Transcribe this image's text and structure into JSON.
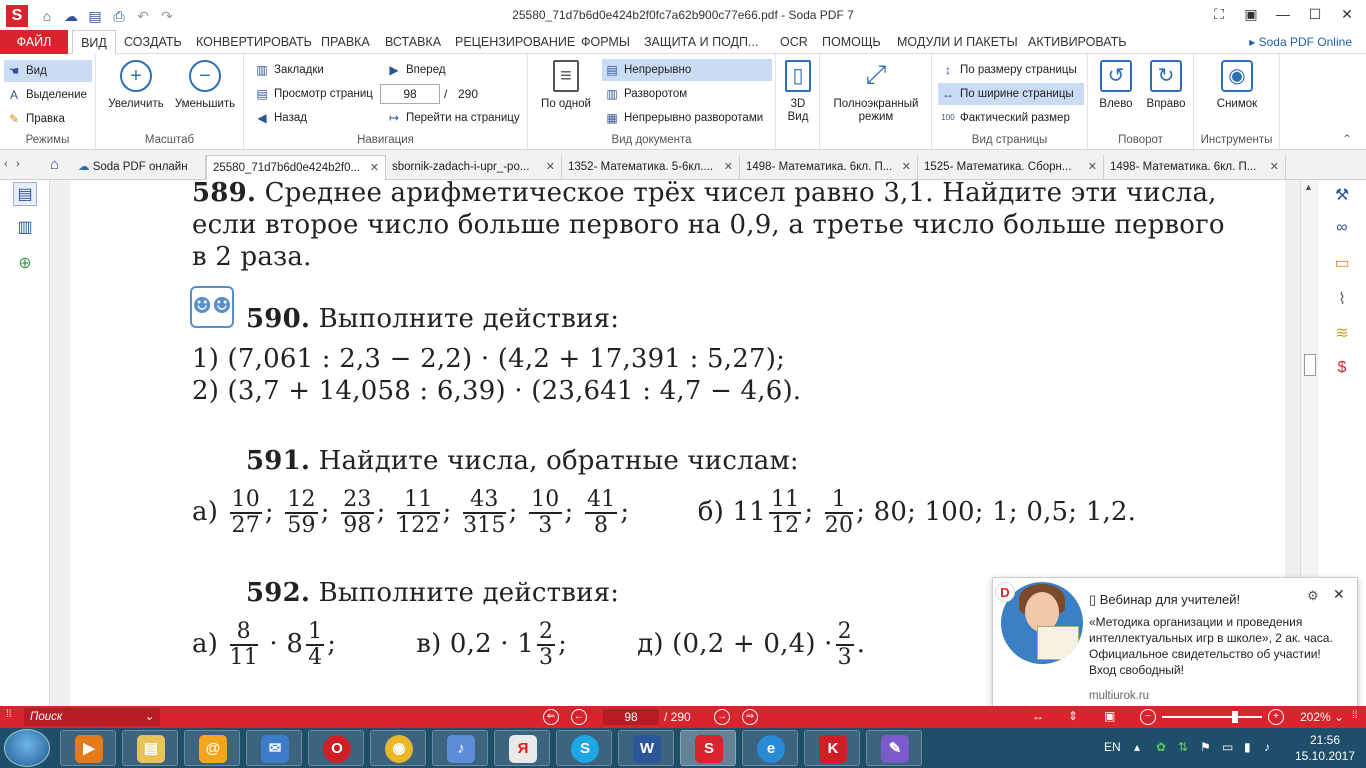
{
  "titlebar": {
    "title": "25580_71d7b6d0e424b2f0fc7a62b900c77e66.pdf   -   Soda PDF 7",
    "app_logo": "S"
  },
  "menu": {
    "file": "ФАЙЛ",
    "items": [
      "ВИД",
      "СОЗДАТЬ",
      "КОНВЕРТИРОВАТЬ",
      "ПРАВКА",
      "ВСТАВКА",
      "РЕЦЕНЗИРОВАНИЕ",
      "ФОРМЫ",
      "ЗАЩИТА И ПОДП...",
      "OCR",
      "ПОМОЩЬ",
      "МОДУЛИ И ПАКЕТЫ",
      "АКТИВИРОВАТЬ"
    ],
    "online": "Soda PDF Online"
  },
  "ribbon": {
    "modes": {
      "items": [
        "Вид",
        "Выделение",
        "Правка"
      ],
      "label": "Режимы"
    },
    "zoom": {
      "zoom_in": "Увеличить",
      "zoom_out": "Уменьшить",
      "label": "Масштаб"
    },
    "navigation": {
      "bookmarks": "Закладки",
      "page_view": "Просмотр страниц",
      "back": "Назад",
      "forward": "Вперед",
      "page_value": "98",
      "page_total": "290",
      "goto": "Перейти на страницу",
      "label": "Навигация"
    },
    "docview": {
      "single": "По одной",
      "continuous": "Непрерывно",
      "spread": "Разворотом",
      "continuous_spread": "Непрерывно разворотами",
      "threed": "3D\nВид",
      "fullscreen": "Полноэкранный\nрежим",
      "label": "Вид документа"
    },
    "pageview": {
      "fit_page": "По размеру страницы",
      "fit_width": "По ширине страницы",
      "actual": "Фактический размер",
      "label": "Вид страницы"
    },
    "rotate": {
      "left": "Влево",
      "right": "Вправо",
      "label": "Поворот"
    },
    "tools": {
      "snapshot": "Снимок",
      "label": "Инструменты"
    }
  },
  "tabs": [
    "Soda PDF онлайн",
    "25580_71d7b6d0e424b2f0...",
    "sbornik-zadach-i-upr_-po...",
    "1352- Математика. 5-6кл....",
    "1498- Математика. 6кл. П...",
    "1525- Математика. Сборн...",
    "1498- Математика. 6кл. П..."
  ],
  "document": {
    "p589_num": "589.",
    "p589_l1": " Среднее арифметическое трёх чисел равно 3,1. Найдите эти числа,",
    "p589_l2": "если второе число больше первого на 0,9, а третье число больше первого",
    "p589_l3": "в 2 раза.",
    "p590_num": "590.",
    "p590_title": " Выполните действия:",
    "p590_l1": "1) (7,061 : 2,3 − 2,2) · (4,2 + 17,391 : 5,27);",
    "p590_l2": "2) (3,7 + 14,058 : 6,39) · (23,641 : 4,7 − 4,6).",
    "p591_num": "591.",
    "p591_title": " Найдите числа, обратные числам:",
    "p591_a": "а)",
    "p591_fracs": [
      [
        "10",
        "27"
      ],
      [
        "12",
        "59"
      ],
      [
        "23",
        "98"
      ],
      [
        "11",
        "122"
      ],
      [
        "43",
        "315"
      ],
      [
        "10",
        "3"
      ],
      [
        "41",
        "8"
      ]
    ],
    "p591_b": "б) 11",
    "p591_b_frac1": [
      "11",
      "12"
    ],
    "p591_b_frac2": [
      "1",
      "20"
    ],
    "p591_b_rest": "; 80; 100; 1; 0,5; 1,2.",
    "p592_num": "592.",
    "p592_title": " Выполните действия:",
    "p592_a_label": "а)",
    "p592_a_frac": [
      "8",
      "11"
    ],
    "p592_a_mid": " · 8",
    "p592_a_frac2": [
      "1",
      "4"
    ],
    "p592_v": "в) 0,2 · 1",
    "p592_v_frac": [
      "2",
      "3"
    ],
    "p592_d": "д) (0,2 + 0,4) ·",
    "p592_d_frac": [
      "2",
      "3"
    ]
  },
  "notification": {
    "title": "Вебинар для учителей!",
    "text": "«Методика организации и проведения интеллектуальных игр в школе», 2 ак. часа. Официальное свидетельство об участии! Вход свободный!",
    "source": "multiurok.ru",
    "badge": "D"
  },
  "statusbar": {
    "search": "Поиск",
    "page": "98",
    "total": "/ 290",
    "zoom": "202%"
  },
  "taskbar": {
    "lang": "EN",
    "time": "21:56",
    "date": "15.10.2017"
  }
}
